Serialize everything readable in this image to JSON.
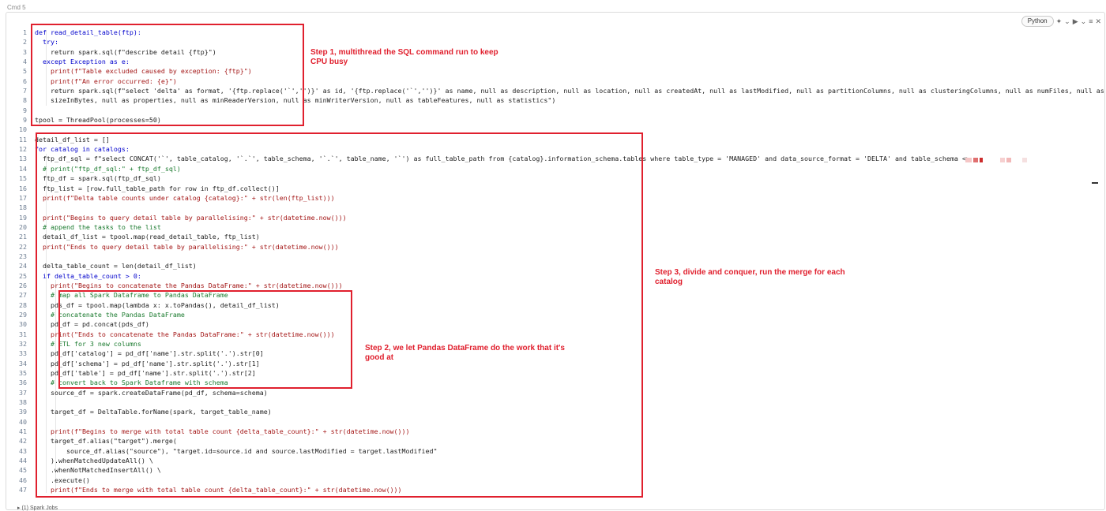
{
  "cell": {
    "command_label": "Cmd 5",
    "language": "Python",
    "footer": "▸ (1) Spark Jobs"
  },
  "icons": [
    "sparkle-icon",
    "chevron-down-icon",
    "run-icon",
    "menu-icon",
    "close-icon"
  ],
  "colors": {
    "annotation": "#e0202e",
    "keyword": "#0000cc",
    "string": "#a31515",
    "comment": "#1a7a2e"
  },
  "annotations": {
    "step1": "Step 1, multithread the SQL command run to keep CPU busy",
    "step2": "Step 2, we let Pandas DataFrame do the work that it's good at",
    "step3": "Step 3, divide and conquer, run the merge for each catalog"
  },
  "code_lines": [
    {
      "num": "1",
      "text": "def read_detail_table(ftp):",
      "kind": "k"
    },
    {
      "num": "2",
      "text": "  try:",
      "kind": "k"
    },
    {
      "num": "3",
      "text": "    return spark.sql(f\"describe detail {ftp}\")",
      "kind": ""
    },
    {
      "num": "4",
      "text": "  except Exception as e:",
      "kind": "k"
    },
    {
      "num": "5",
      "text": "    print(f\"Table excluded caused by exception: {ftp}\")",
      "kind": "s"
    },
    {
      "num": "6",
      "text": "    print(f\"An error occurred: {e}\")",
      "kind": "s"
    },
    {
      "num": "7",
      "text": "    return spark.sql(f\"select 'delta' as format, '{ftp.replace('`','')}' as id, '{ftp.replace('`','')}' as name, null as description, null as location, null as createdAt, null as lastModified, null as partitionColumns, null as clusteringColumns, null as numFiles, null as",
      "kind": ""
    },
    {
      "num": "8",
      "text": "    sizeInBytes, null as properties, null as minReaderVersion, null as minWriterVersion, null as tableFeatures, null as statistics\")",
      "kind": ""
    },
    {
      "num": "9",
      "text": "",
      "kind": ""
    },
    {
      "num": "9",
      "text": "tpool = ThreadPool(processes=50)",
      "kind": ""
    },
    {
      "num": "10",
      "text": "",
      "kind": ""
    },
    {
      "num": "11",
      "text": "detail_df_list = []",
      "kind": ""
    },
    {
      "num": "12",
      "text": "for catalog in catalogs:",
      "kind": "k"
    },
    {
      "num": "13",
      "text": "  ftp_df_sql = f\"select CONCAT('`', table_catalog, '`.`', table_schema, '`.`', table_name, '`') as full_table_path from {catalog}.information_schema.tables where table_type = 'MANAGED' and data_source_format = 'DELTA' and table_schema <>",
      "kind": ""
    },
    {
      "num": "14",
      "text": "  # print(\"ftp_df_sql:\" + ftp_df_sql)",
      "kind": "c"
    },
    {
      "num": "15",
      "text": "  ftp_df = spark.sql(ftp_df_sql)",
      "kind": ""
    },
    {
      "num": "16",
      "text": "  ftp_list = [row.full_table_path for row in ftp_df.collect()]",
      "kind": ""
    },
    {
      "num": "17",
      "text": "  print(f\"Delta table counts under catalog {catalog}:\" + str(len(ftp_list)))",
      "kind": "s"
    },
    {
      "num": "18",
      "text": "",
      "kind": ""
    },
    {
      "num": "19",
      "text": "  print(\"Begins to query detail table by parallelising:\" + str(datetime.now()))",
      "kind": "s"
    },
    {
      "num": "20",
      "text": "  # append the tasks to the list",
      "kind": "c"
    },
    {
      "num": "21",
      "text": "  detail_df_list = tpool.map(read_detail_table, ftp_list)",
      "kind": ""
    },
    {
      "num": "22",
      "text": "  print(\"Ends to query detail table by parallelising:\" + str(datetime.now()))",
      "kind": "s"
    },
    {
      "num": "23",
      "text": "",
      "kind": ""
    },
    {
      "num": "24",
      "text": "  delta_table_count = len(detail_df_list)",
      "kind": ""
    },
    {
      "num": "25",
      "text": "  if delta_table_count > 0:",
      "kind": "k"
    },
    {
      "num": "26",
      "text": "    print(\"Begins to concatenate the Pandas DataFrame:\" + str(datetime.now()))",
      "kind": "s"
    },
    {
      "num": "27",
      "text": "    # map all Spark Dataframe to Pandas DataFrame",
      "kind": "c"
    },
    {
      "num": "28",
      "text": "    pds_df = tpool.map(lambda x: x.toPandas(), detail_df_list)",
      "kind": ""
    },
    {
      "num": "29",
      "text": "    # concatenate the Pandas DataFrame",
      "kind": "c"
    },
    {
      "num": "30",
      "text": "    pd_df = pd.concat(pds_df)",
      "kind": ""
    },
    {
      "num": "31",
      "text": "    print(\"Ends to concatenate the Pandas DataFrame:\" + str(datetime.now()))",
      "kind": "s"
    },
    {
      "num": "32",
      "text": "    # ETL for 3 new columns",
      "kind": "c"
    },
    {
      "num": "33",
      "text": "    pd_df['catalog'] = pd_df['name'].str.split('.').str[0]",
      "kind": ""
    },
    {
      "num": "34",
      "text": "    pd_df['schema'] = pd_df['name'].str.split('.').str[1]",
      "kind": ""
    },
    {
      "num": "35",
      "text": "    pd_df['table'] = pd_df['name'].str.split('.').str[2]",
      "kind": ""
    },
    {
      "num": "36",
      "text": "    # convert back to Spark Dataframe with schema",
      "kind": "c"
    },
    {
      "num": "37",
      "text": "    source_df = spark.createDataFrame(pd_df, schema=schema)",
      "kind": ""
    },
    {
      "num": "38",
      "text": "",
      "kind": ""
    },
    {
      "num": "39",
      "text": "    target_df = DeltaTable.forName(spark, target_table_name)",
      "kind": ""
    },
    {
      "num": "40",
      "text": "",
      "kind": ""
    },
    {
      "num": "41",
      "text": "    print(f\"Begins to merge with total table count {delta_table_count}:\" + str(datetime.now()))",
      "kind": "s"
    },
    {
      "num": "42",
      "text": "    target_df.alias(\"target\").merge(",
      "kind": ""
    },
    {
      "num": "43",
      "text": "        source_df.alias(\"source\"), \"target.id=source.id and source.lastModified = target.lastModified\"",
      "kind": ""
    },
    {
      "num": "44",
      "text": "    ).whenMatchedUpdateAll() \\",
      "kind": ""
    },
    {
      "num": "45",
      "text": "    .whenNotMatchedInsertAll() \\",
      "kind": ""
    },
    {
      "num": "46",
      "text": "    .execute()",
      "kind": ""
    },
    {
      "num": "47",
      "text": "    print(f\"Ends to merge with total table count {delta_table_count}:\" + str(datetime.now()))",
      "kind": "s"
    }
  ]
}
